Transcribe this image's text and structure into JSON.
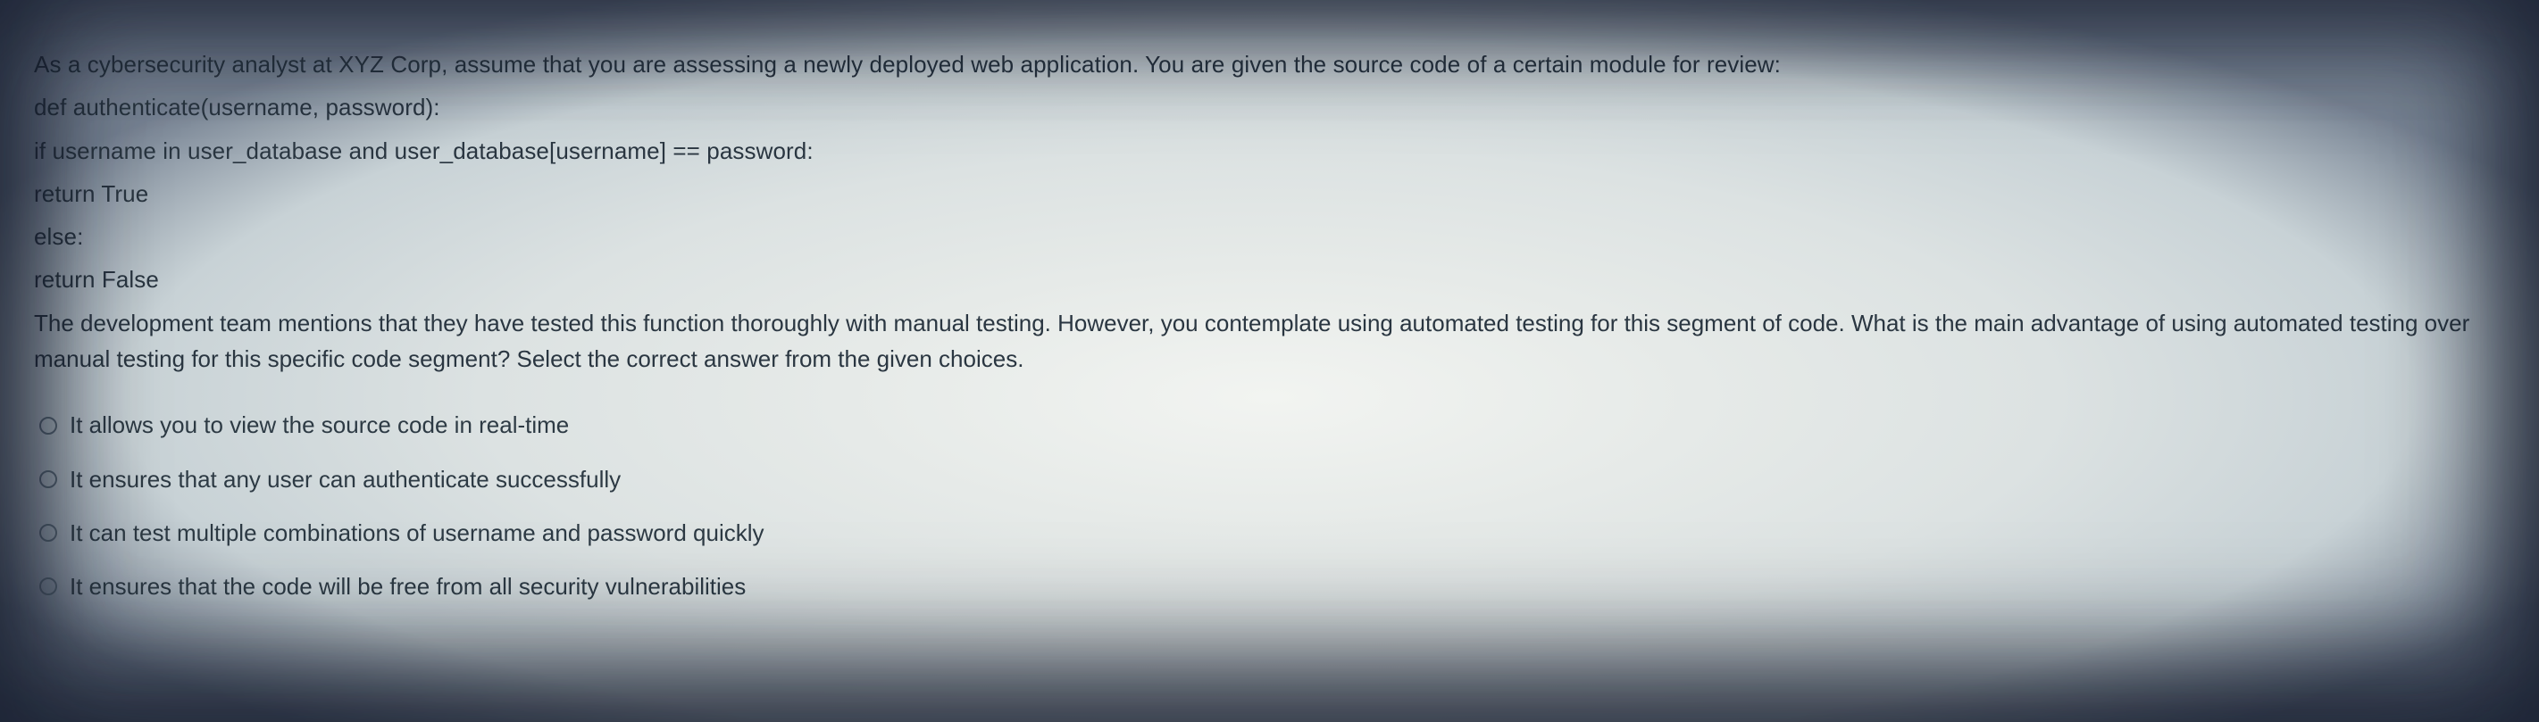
{
  "question": {
    "lines": [
      "As a cybersecurity analyst at XYZ Corp, assume that you are assessing a newly deployed web application. You are given the source code of a certain module for review:",
      "def authenticate(username, password):",
      "if username in user_database and user_database[username] == password:",
      "return True",
      "else:",
      "return False",
      "The development team mentions that they have tested this function thoroughly with manual testing. However, you contemplate using automated testing for this segment of code. What is the main advantage of using automated testing over manual testing for this specific code segment? Select the correct answer from the given choices."
    ]
  },
  "choices": [
    {
      "label": "It allows you to view the source code in real-time"
    },
    {
      "label": "It ensures that any user can authenticate successfully"
    },
    {
      "label": "It can test multiple combinations of username and password quickly"
    },
    {
      "label": "It ensures that the code will be free from all security vulnerabilities"
    }
  ]
}
